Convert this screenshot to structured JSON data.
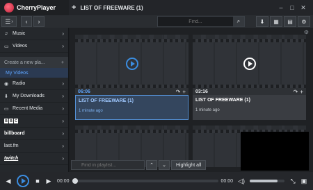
{
  "app": {
    "name": "CherryPlayer"
  },
  "tab": {
    "plus": "+",
    "title": "LIST OF FREEWARE (1)"
  },
  "window_buttons": [
    "–",
    "□",
    "✕"
  ],
  "toolbar": {
    "menu_icon": "☰",
    "menu_chevron": "›",
    "back": "‹",
    "forward": "›",
    "search_placeholder": "Find...",
    "search_icon": "⌕",
    "tools": [
      "⬇",
      "▦",
      "▤",
      "⚙"
    ]
  },
  "sidebar": {
    "items_top": [
      {
        "icon": "♫",
        "label": "Music",
        "chevron": "›"
      },
      {
        "icon": "▭",
        "label": "Videos",
        "chevron": "›"
      }
    ],
    "create_label": "Create a new pla...",
    "create_plus": "+",
    "active_item": "My Videos",
    "items_bottom": [
      {
        "icon": "◉",
        "label": "Radio",
        "chevron": "›"
      },
      {
        "icon": "⬇",
        "label": "My Downloads",
        "chevron": "›"
      },
      {
        "icon": "▭",
        "label": "Recent Media",
        "chevron": "›"
      }
    ],
    "brands": [
      {
        "label": "BBC",
        "letters": [
          "B",
          "B",
          "C"
        ],
        "chevron": "›"
      },
      {
        "label": "billboard",
        "chevron": "›"
      },
      {
        "label": "last.fm",
        "chevron": "›"
      },
      {
        "label": "twitch",
        "chevron": "›"
      }
    ]
  },
  "content": {
    "corner_icon": "⚙",
    "cards": [
      {
        "duration": "06:06",
        "title": "LIST OF FREEWARE (1)",
        "time": "1 minute ago",
        "selected": true
      },
      {
        "duration": "03:16",
        "title": "LIST OF FREEWARE (1)",
        "time": "1 minute ago",
        "selected": false
      }
    ],
    "card_actions": [
      "↷",
      "+"
    ],
    "find_placeholder": "Find in playlist...",
    "find_up": "⌃",
    "find_down": "⌄",
    "highlight_label": "Highlight all"
  },
  "player": {
    "prev": "◀",
    "stop": "■",
    "next": "▶",
    "time_current": "00:00",
    "time_total": "00:00",
    "volume_icon": "◁)",
    "volume_level": 0.8,
    "extra": [
      "⤡",
      "▣"
    ]
  },
  "colors": {
    "accent": "#3b8de0",
    "background": "#1b1d20"
  }
}
